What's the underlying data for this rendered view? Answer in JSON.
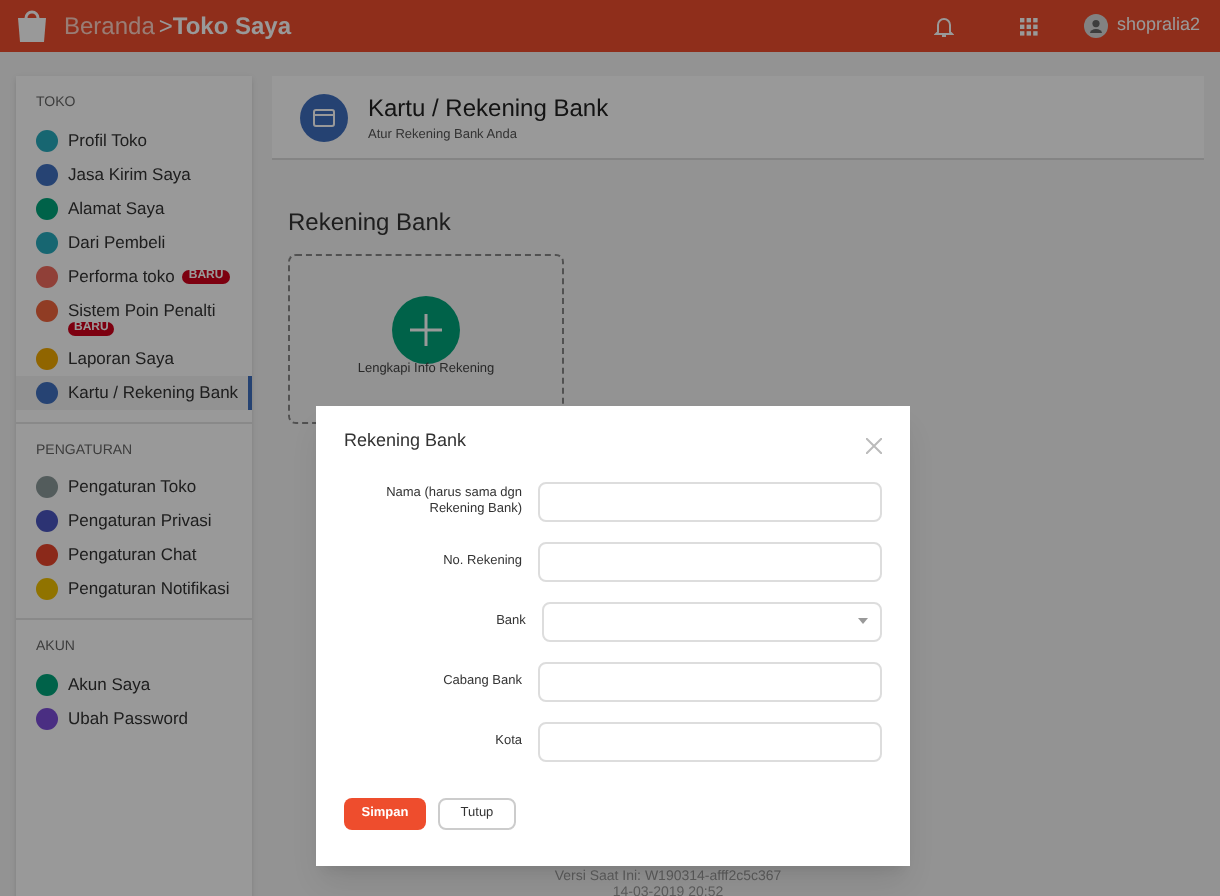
{
  "topbar": {
    "breadcrumb_home": "Beranda",
    "breadcrumb_separator": ">",
    "breadcrumb_current": "Toko Saya",
    "username": "shopralia2"
  },
  "sidebar": {
    "sections": [
      {
        "title": "TOKO",
        "items": [
          {
            "label": "Profil Toko",
            "color": "#176671",
            "selected": false
          },
          {
            "label": "Jasa Kirim Saya",
            "color": "#264373",
            "selected": false
          },
          {
            "label": "Alamat Saya",
            "color": "#006249",
            "selected": false
          },
          {
            "label": "Dari Pembeli",
            "color": "#176671",
            "selected": false
          },
          {
            "label": "Performa toko",
            "color": "#904038",
            "selected": false,
            "badge": "BARU"
          },
          {
            "label": "Sistem Poin Penalti",
            "color": "#903c24",
            "selected": false,
            "badge": "BARU"
          },
          {
            "label": "Laporan Saya",
            "color": "#906500",
            "selected": false
          },
          {
            "label": "Kartu / Rekening Bank",
            "color": "#264373",
            "selected": true
          }
        ]
      },
      {
        "title": "PENGATURAN",
        "items": [
          {
            "label": "Pengaturan Toko",
            "color": "#535c5c",
            "selected": false
          },
          {
            "label": "Pengaturan Privasi",
            "color": "#2c3373",
            "selected": false
          },
          {
            "label": "Pengaturan Chat",
            "color": "#8b291a",
            "selected": false
          },
          {
            "label": "Pengaturan Notifikasi",
            "color": "#907300",
            "selected": false
          }
        ]
      },
      {
        "title": "AKUN",
        "items": [
          {
            "label": "Akun Saya",
            "color": "#006249",
            "selected": false
          },
          {
            "label": "Ubah Password",
            "color": "#4a2e82",
            "selected": false
          }
        ]
      }
    ]
  },
  "page_header": {
    "title": "Kartu / Rekening Bank",
    "subtitle": "Atur Rekening Bank Anda"
  },
  "section_title": "Rekening Bank",
  "add_card": {
    "label": "Lengkapi Info Rekening"
  },
  "footer": {
    "version": "Versi Saat Ini: W190314-afff2c5c367",
    "date": "14-03-2019 20:52"
  },
  "dialog": {
    "title": "Rekening Bank",
    "fields": [
      {
        "label": "Nama (harus sama dgn Rekening Bank)",
        "kind": "text"
      },
      {
        "label": "No. Rekening",
        "kind": "text"
      },
      {
        "label": "Bank",
        "kind": "select"
      },
      {
        "label": "Cabang Bank",
        "kind": "text"
      },
      {
        "label": "Kota",
        "kind": "text"
      }
    ],
    "primary_button": "Simpan",
    "secondary_button": "Tutup"
  }
}
